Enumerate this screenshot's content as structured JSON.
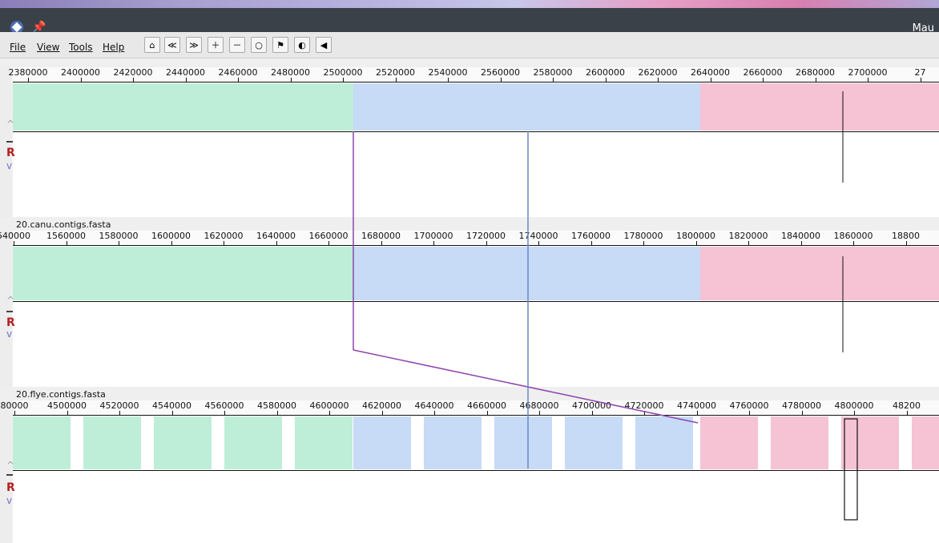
{
  "window": {
    "title": "Mau",
    "colors": {
      "titlebar": "#3b4148"
    }
  },
  "menubar": {
    "items": [
      {
        "label": "File"
      },
      {
        "label": "View"
      },
      {
        "label": "Tools"
      },
      {
        "label": "Help"
      }
    ]
  },
  "toolbar": {
    "buttons": [
      {
        "icon": "home-icon"
      },
      {
        "icon": "scroll-left-icon"
      },
      {
        "icon": "scroll-right-icon"
      },
      {
        "icon": "zoom-in-icon"
      },
      {
        "icon": "zoom-out-icon"
      },
      {
        "icon": "zoom-reset-icon"
      },
      {
        "icon": "flip-icon"
      },
      {
        "icon": "color-icon"
      },
      {
        "icon": "nav-left-icon"
      }
    ]
  },
  "genomes": [
    {
      "name": "",
      "ticks": [
        "2380000",
        "2400000",
        "2420000",
        "2440000",
        "2460000",
        "2480000",
        "2500000",
        "2520000",
        "2540000",
        "2560000",
        "2580000",
        "2600000",
        "2620000",
        "2640000",
        "2660000",
        "2680000",
        "2700000",
        "27"
      ],
      "blocks": [
        {
          "color": "#bfeed8"
        },
        {
          "color": "#c7daf6"
        },
        {
          "color": "#f5c3d3"
        }
      ]
    },
    {
      "name": "20.canu.contigs.fasta",
      "ticks": [
        "540000",
        "1560000",
        "1580000",
        "1600000",
        "1620000",
        "1640000",
        "1660000",
        "1680000",
        "1700000",
        "1720000",
        "1740000",
        "1760000",
        "1780000",
        "1800000",
        "1820000",
        "1840000",
        "1860000",
        "18800"
      ],
      "blocks": [
        {
          "color": "#bfeed8"
        },
        {
          "color": "#c7daf6"
        },
        {
          "color": "#f5c3d3"
        }
      ]
    },
    {
      "name": "20.flye.contigs.fasta",
      "ticks": [
        "80000",
        "4500000",
        "4520000",
        "4540000",
        "4560000",
        "4580000",
        "4600000",
        "4620000",
        "4640000",
        "4660000",
        "4680000",
        "4700000",
        "4720000",
        "4740000",
        "4760000",
        "4780000",
        "4800000",
        "48200"
      ],
      "blocks": [
        {
          "color": "#bfeed8"
        },
        {
          "color": "#c7daf6"
        },
        {
          "color": "#f5c3d3"
        }
      ]
    }
  ],
  "side_controls": {
    "r_label": "R",
    "arrow_up": "^",
    "arrow_down": "v"
  },
  "connectors": {
    "colors": {
      "purple": "#8e44ad",
      "blue": "#6a87c7",
      "black": "#111111"
    }
  }
}
